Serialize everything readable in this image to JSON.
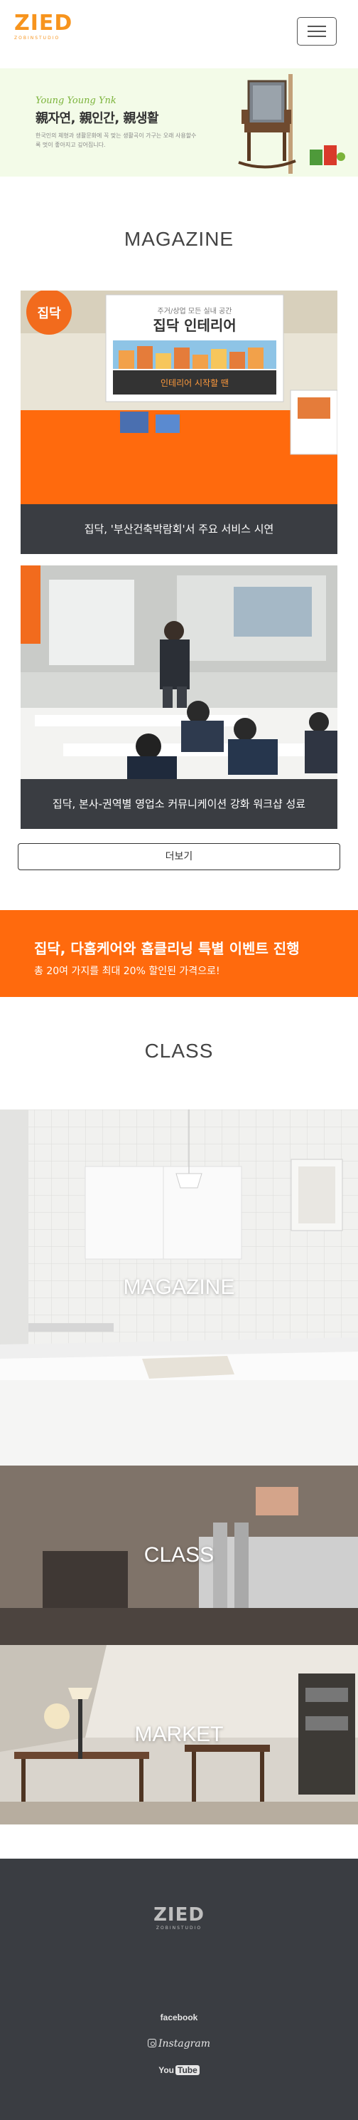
{
  "header": {
    "logo_text": "ZIED",
    "logo_sub": "ZOBINSTUDIO",
    "menu_icon": "hamburger-menu-icon"
  },
  "banner": {
    "script": "Young Young Ynk",
    "headline": "親자연, 親인간, 親생활",
    "desc": "한국인의 체형과 생활문화에 꼭 맞는 생활곡이 가구는 오래 사용할수록 멋이 좋아지고 깊어집니다."
  },
  "magazine": {
    "title": "MAGAZINE",
    "cards": [
      {
        "caption": "집닥, '부산건축박람회'서 주요 서비스 시연",
        "sign_brand": "집닥",
        "sign_text": "집닥 인테리어",
        "sign_top": "주거/상업 모든 실내 공간",
        "sign_banner": "인테리어 시작할 땐"
      },
      {
        "caption": "집닥, 본사-권역별 영업소 커뮤니케이션 강화 워크샵 성료"
      }
    ],
    "more_label": "더보기"
  },
  "event": {
    "title": "집닥, 다홈케어와 홈클리닝 특별 이벤트 진행",
    "sub": "총 20여 가지를 최대 20% 할인된 가격으로!"
  },
  "class": {
    "title": "CLASS",
    "tiles": [
      {
        "label": "MAGAZINE"
      },
      {
        "label": "CLASS"
      },
      {
        "label": "MARKET"
      }
    ]
  },
  "footer": {
    "logo_text": "ZIED",
    "logo_sub": "ZOBINSTUDIO",
    "facebook": "facebook",
    "instagram": "Instagram",
    "youtube_you": "You",
    "youtube_tube": "Tube"
  },
  "colors": {
    "brand_orange": "#f7941d",
    "event_orange": "#ff6a0d",
    "footer_bg": "#3a3d42",
    "caption_bg": "#3a3d42"
  }
}
